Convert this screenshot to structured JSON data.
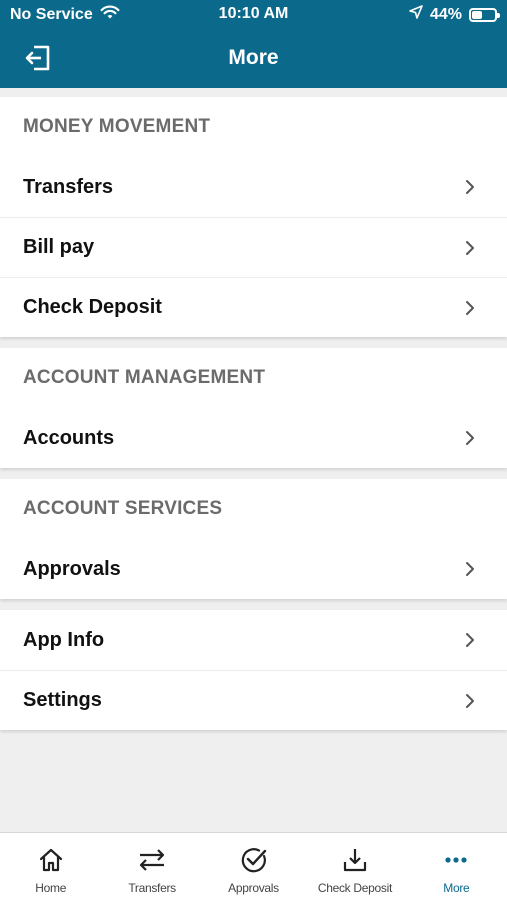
{
  "status_bar": {
    "carrier": "No Service",
    "time": "10:10 AM",
    "battery": "44%",
    "battery_level": 0.44
  },
  "header": {
    "title": "More",
    "bg_color": "#0b6a8c"
  },
  "sections": {
    "money_movement": {
      "title": "MONEY MOVEMENT",
      "items": [
        "Transfers",
        "Bill pay",
        "Check Deposit"
      ]
    },
    "account_management": {
      "title": "ACCOUNT MANAGEMENT",
      "items": [
        "Accounts"
      ]
    },
    "account_services": {
      "title": "ACCOUNT SERVICES",
      "items": [
        "Approvals"
      ]
    },
    "misc": {
      "items": [
        "App Info",
        "Settings"
      ]
    }
  },
  "bottom_nav": {
    "items": [
      {
        "label": "Home",
        "icon": "home-icon"
      },
      {
        "label": "Transfers",
        "icon": "transfer-arrows-icon"
      },
      {
        "label": "Approvals",
        "icon": "check-circle-icon"
      },
      {
        "label": "Check Deposit",
        "icon": "download-tray-icon"
      },
      {
        "label": "More",
        "icon": "more-dots-icon"
      }
    ],
    "active_index": 4,
    "active_color": "#0b6a8c"
  }
}
